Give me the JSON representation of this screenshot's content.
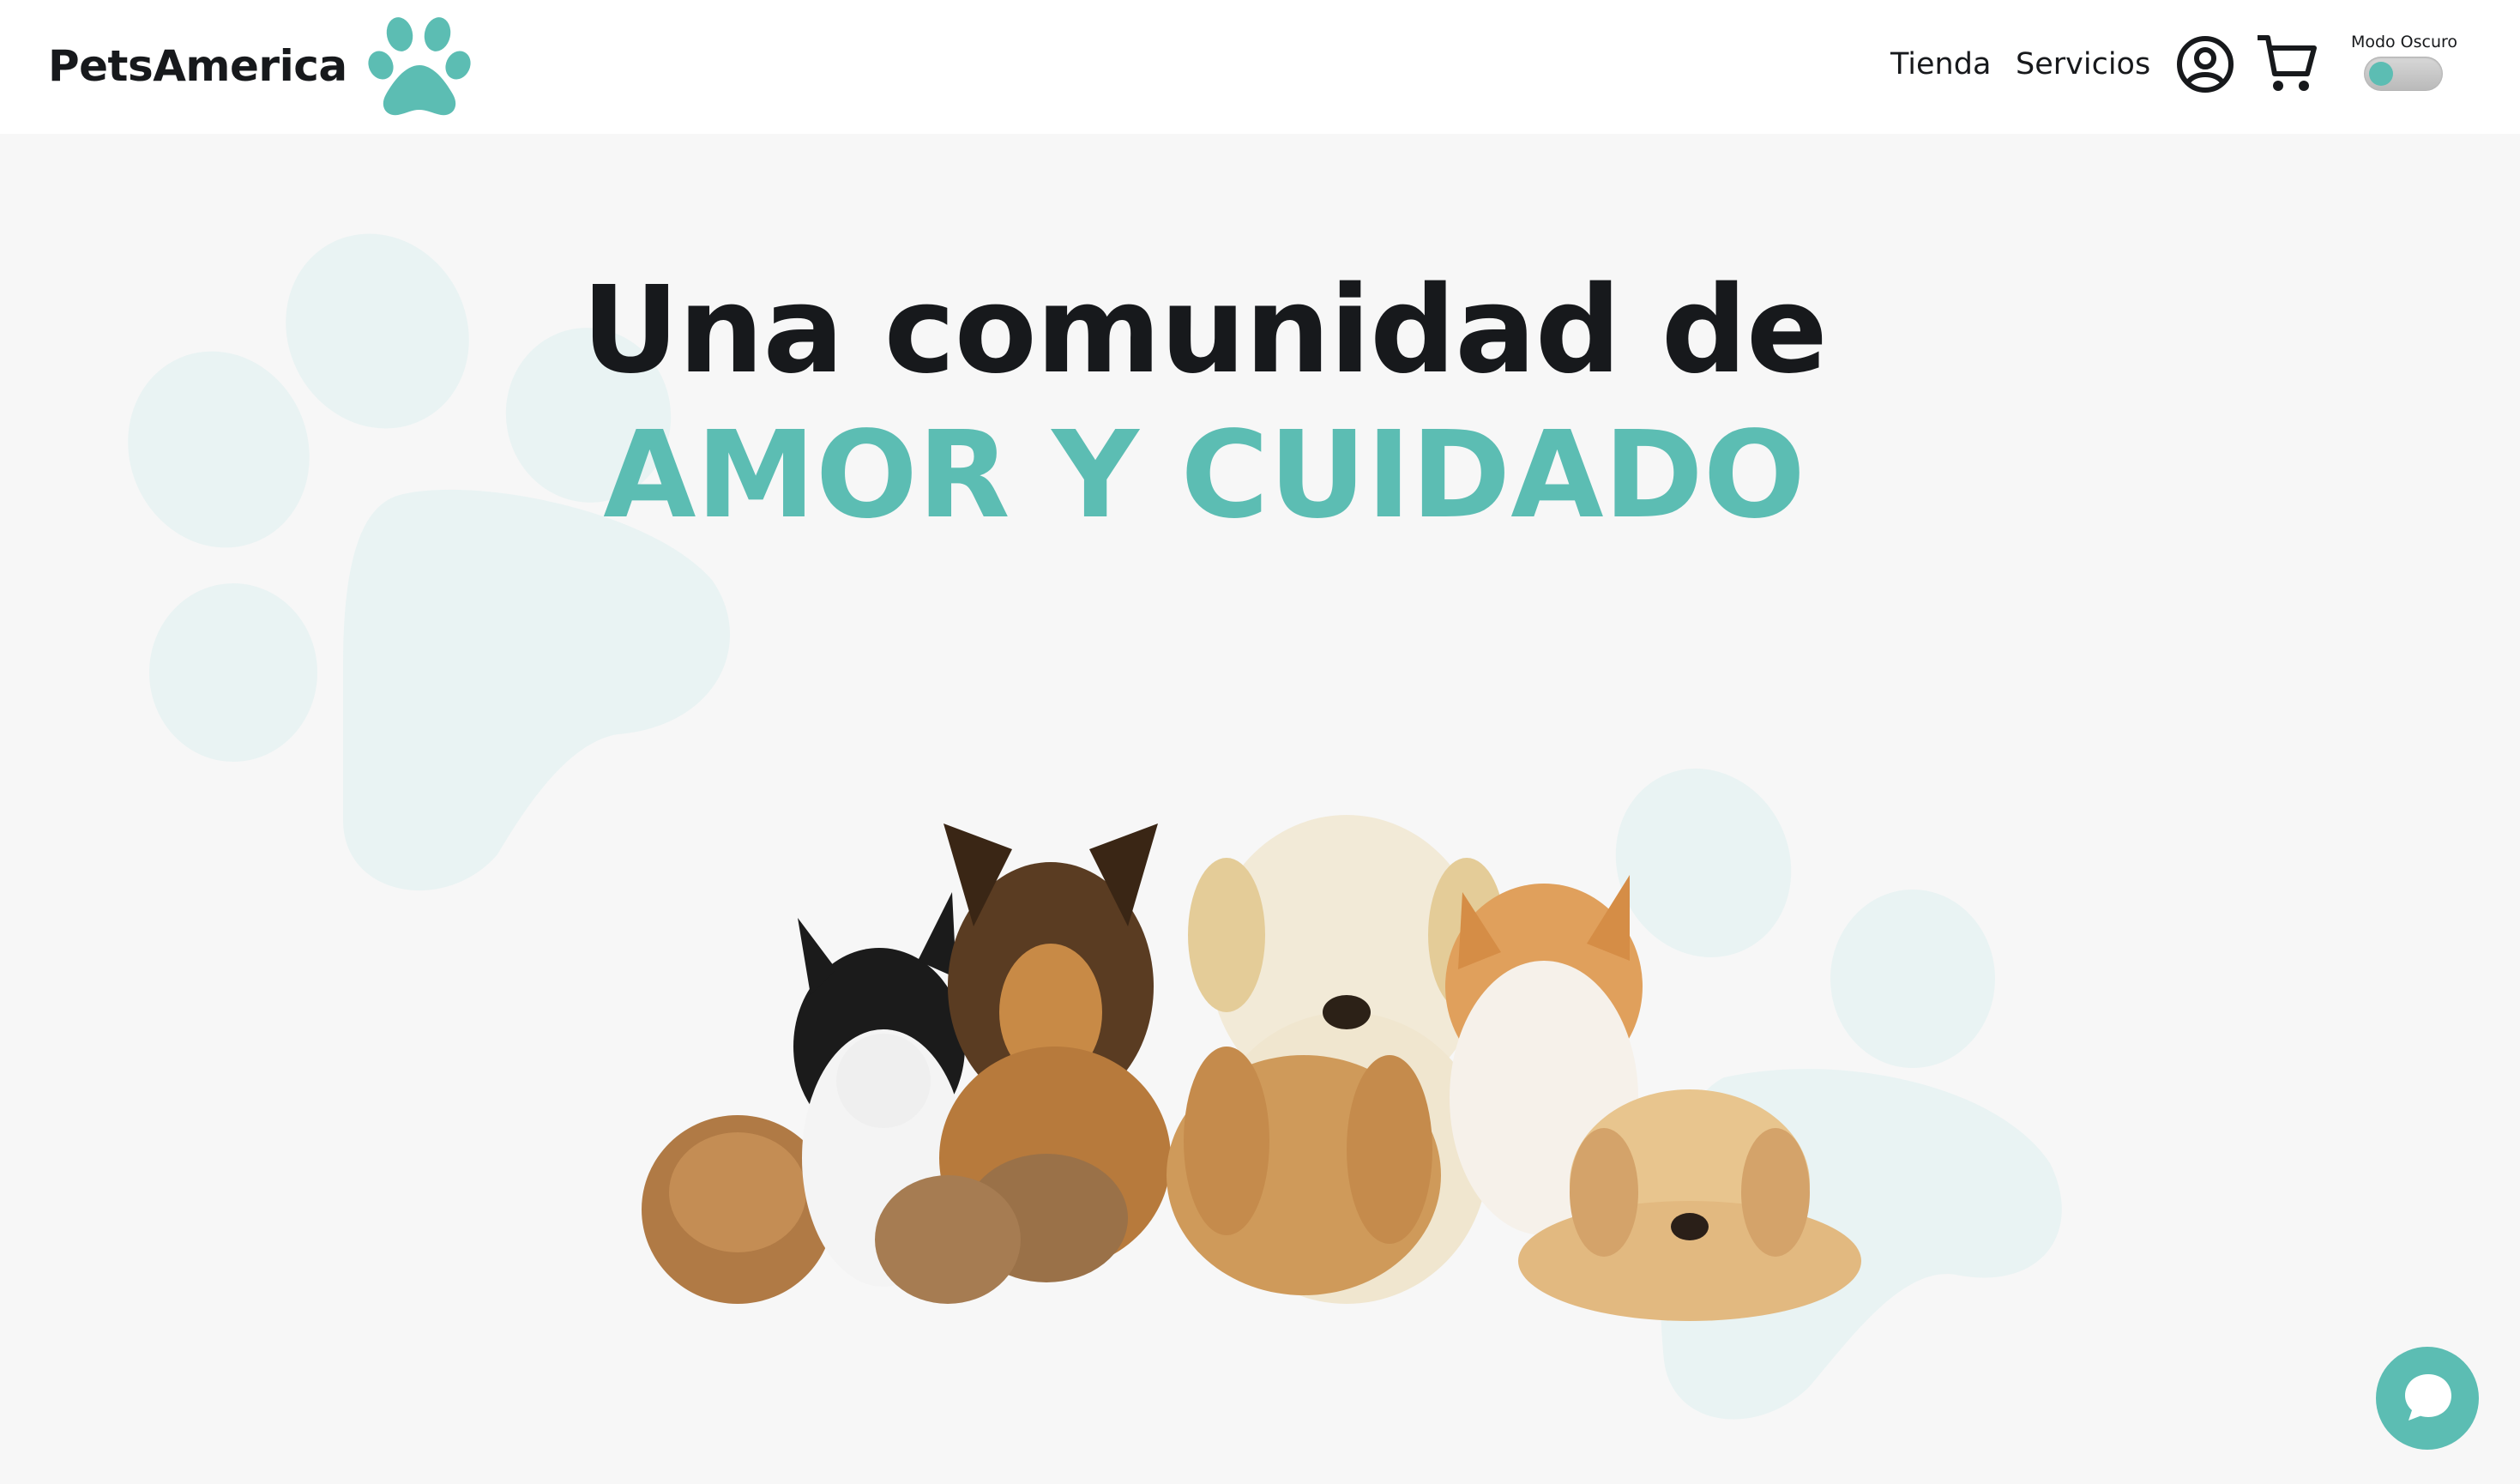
{
  "header": {
    "brand": "PetsAmerica",
    "nav": [
      {
        "label": "Tienda"
      },
      {
        "label": "Servicios"
      }
    ],
    "icons": [
      "user-icon",
      "cart-icon"
    ],
    "dark_mode_label": "Modo Oscuro",
    "dark_mode_on": false
  },
  "hero": {
    "line1": "Una comunidad de",
    "line2": "AMOR Y CUIDADO",
    "image_subject": "group of pets: puppies, kittens, rabbit, guinea pig"
  },
  "colors": {
    "accent": "#5cbdb3",
    "text": "#17191c",
    "background": "#f7f7f7",
    "paw_bg": "#e8f2f2"
  },
  "chat": {
    "icon": "chat-bubble-icon"
  }
}
